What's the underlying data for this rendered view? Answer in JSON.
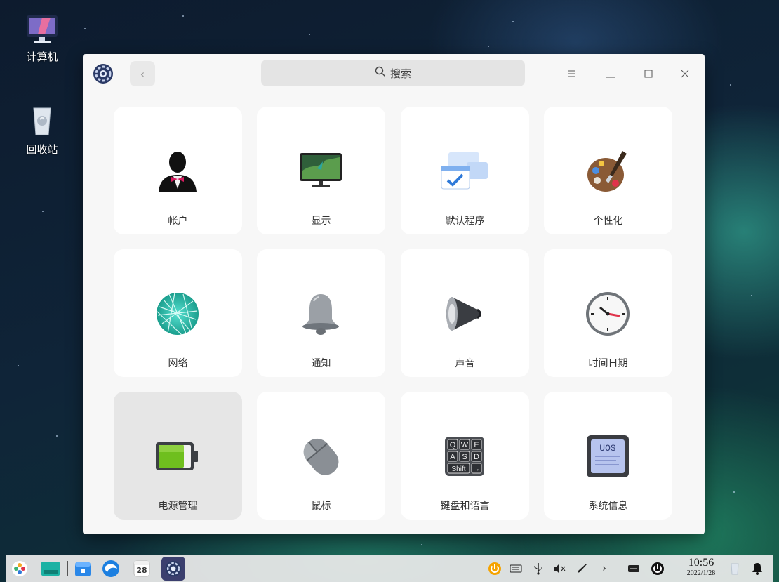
{
  "desktop": {
    "icons": [
      {
        "label": "计算机",
        "icon": "computer-icon"
      },
      {
        "label": "回收站",
        "icon": "trash-icon"
      }
    ]
  },
  "window": {
    "search": {
      "label": "搜索"
    },
    "title_buttons": [
      "menu",
      "minimize",
      "maximize",
      "close"
    ]
  },
  "modules": [
    {
      "label": "帐户",
      "icon": "account-icon"
    },
    {
      "label": "显示",
      "icon": "display-icon"
    },
    {
      "label": "默认程序",
      "icon": "default-apps-icon"
    },
    {
      "label": "个性化",
      "icon": "personalization-icon"
    },
    {
      "label": "网络",
      "icon": "network-icon"
    },
    {
      "label": "通知",
      "icon": "notification-icon"
    },
    {
      "label": "声音",
      "icon": "sound-icon"
    },
    {
      "label": "时间日期",
      "icon": "datetime-icon"
    },
    {
      "label": "电源管理",
      "icon": "power-management-icon",
      "selected": true
    },
    {
      "label": "鼠标",
      "icon": "mouse-icon"
    },
    {
      "label": "键盘和语言",
      "icon": "keyboard-language-icon"
    },
    {
      "label": "系统信息",
      "icon": "system-info-icon"
    }
  ],
  "keyboard_keys": [
    "Q",
    "W",
    "E",
    "A",
    "S",
    "D",
    "Shift",
    "→"
  ],
  "system_info_badge": "UOS",
  "taskbar": {
    "calendar_day": "28",
    "clock_time": "10:56",
    "clock_date": "2022/1/28"
  },
  "colors": {
    "window_bg": "#f7f7f7",
    "card_bg": "#ffffff",
    "selected_card_bg": "#e6e6e6",
    "accent": "#2f7ad9"
  }
}
